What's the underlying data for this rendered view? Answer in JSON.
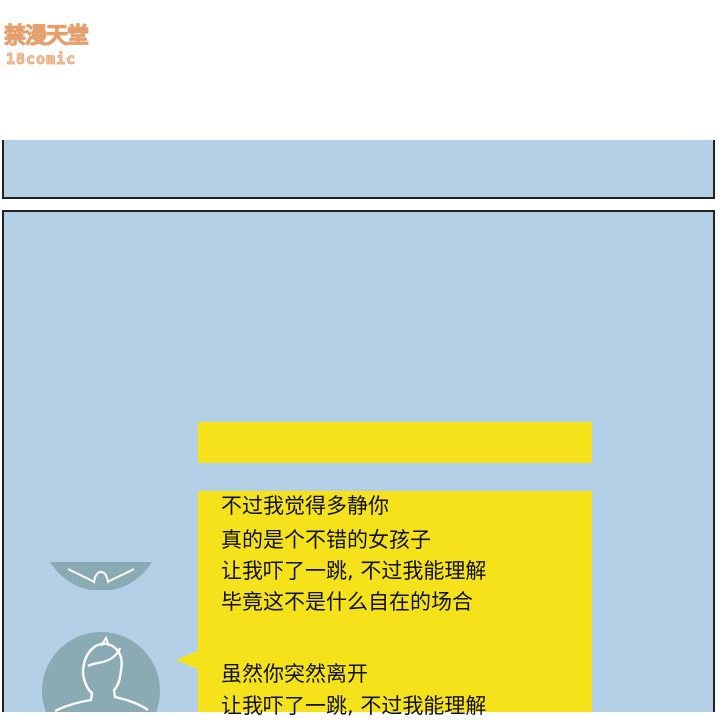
{
  "watermark": {
    "site_name": "禁漫天堂",
    "site_domain": "18comic"
  },
  "dialogue": {
    "lines": [
      "不过我觉得多静你",
      "真的是个不错的女孩子",
      "让我吓了一跳, 不过我能理解",
      "毕竟这不是什么自在的场合",
      "虽然你突然离开",
      "让我吓了一跳, 不过我能理解"
    ]
  },
  "colors": {
    "panel_background": "#b3d0e7",
    "bubble": "#f5e21a",
    "avatar": "#8aaab4",
    "watermark": "#f7c9a3"
  },
  "icons": {
    "avatar_top": "person-avatar-icon",
    "avatar_bottom": "person-avatar-icon"
  }
}
